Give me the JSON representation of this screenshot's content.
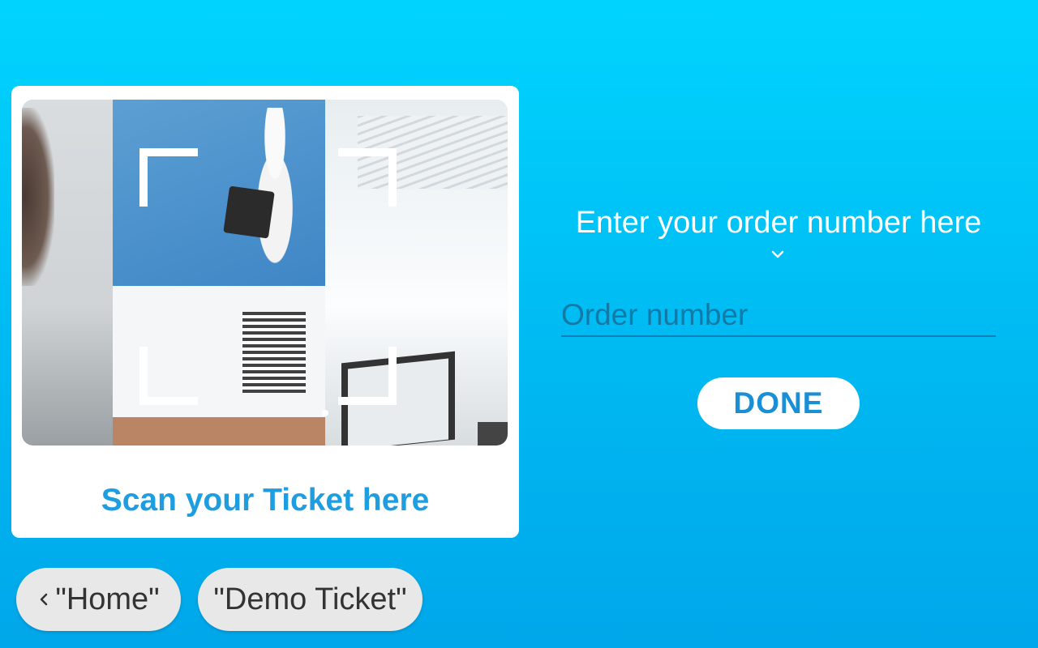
{
  "scanner": {
    "caption": "Scan your Ticket here"
  },
  "order": {
    "prompt": "Enter your order number here",
    "input_placeholder": "Order number",
    "input_value": "",
    "done_label": "DONE"
  },
  "chips": {
    "home_label": "\"Home\"",
    "demo_label": "\"Demo Ticket\""
  },
  "icons": {
    "prompt_chevron": "chevron-down-icon",
    "home_chevron": "chevron-left-icon"
  },
  "colors": {
    "background_top": "#00d4fe",
    "background_bottom": "#00a7ea",
    "accent": "#1e9ee0"
  }
}
